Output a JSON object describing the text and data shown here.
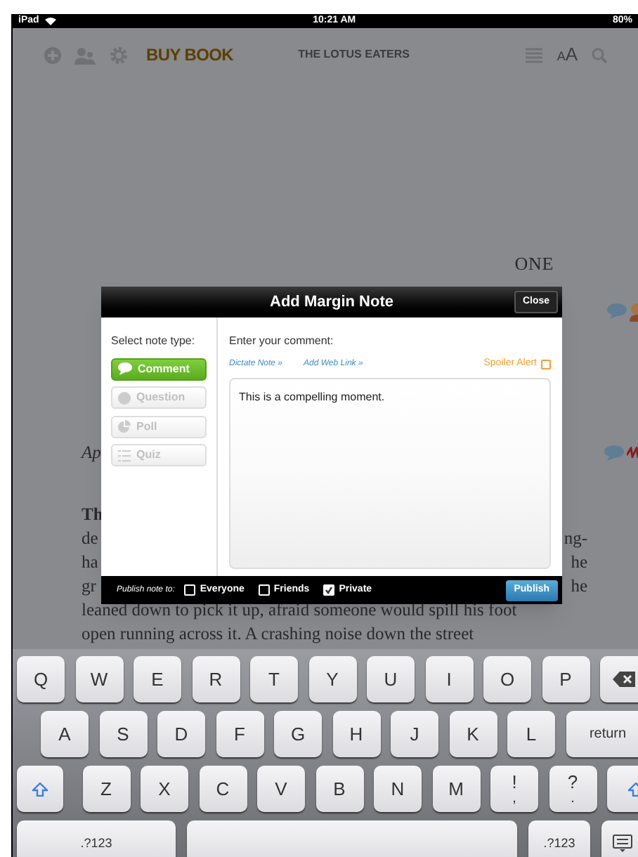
{
  "status_bar": {
    "device": "iPad",
    "time": "10:21 AM",
    "battery": "80%"
  },
  "toolbar": {
    "buy_button": "BUY BOOK",
    "title": "THE LOTUS EATERS",
    "font_button": "AA"
  },
  "book": {
    "chapter": "ONE",
    "lines": [
      {
        "kind": "italic",
        "left": "Ap"
      },
      {
        "kind": "bold",
        "left": "Th"
      },
      {
        "kind": "plain",
        "left": "de",
        "right": "ng-"
      },
      {
        "kind": "plain",
        "left": "ha",
        "right": "he"
      },
      {
        "kind": "plain",
        "left": "gr",
        "right": "he"
      },
      {
        "kind": "plain",
        "left": "leaned down to pick it up, afraid someone would spill his foot"
      },
      {
        "kind": "plain",
        "left": "open running across it. A crashing noise down the street"
      }
    ]
  },
  "dialog": {
    "title": "Add Margin Note",
    "close": "Close",
    "type_label": "Select note type:",
    "note_types": [
      {
        "kind": "comment",
        "label": "Comment",
        "selected": true
      },
      {
        "kind": "question",
        "label": "Question",
        "selected": false
      },
      {
        "kind": "poll",
        "label": "Poll",
        "selected": false
      },
      {
        "kind": "quiz",
        "label": "Quiz",
        "selected": false
      }
    ],
    "comment_label": "Enter your comment:",
    "links": [
      "Dictate Note »",
      "Add Web Link »"
    ],
    "spoiler": {
      "label": "Spoiler Alert",
      "checked": false
    },
    "comment": "This is a compelling moment.",
    "publish_label": "Publish note to:",
    "audiences": [
      {
        "label": "Everyone",
        "checked": false
      },
      {
        "label": "Friends",
        "checked": false
      },
      {
        "label": "Private",
        "checked": true
      }
    ],
    "publish_button": "Publish"
  },
  "keyboard": {
    "rows": [
      {
        "keys": [
          {
            "kind": "letter",
            "label": "Q"
          },
          {
            "kind": "letter",
            "label": "W"
          },
          {
            "kind": "letter",
            "label": "E"
          },
          {
            "kind": "letter",
            "label": "R"
          },
          {
            "kind": "letter",
            "label": "T"
          },
          {
            "kind": "letter",
            "label": "Y"
          },
          {
            "kind": "letter",
            "label": "U"
          },
          {
            "kind": "letter",
            "label": "I"
          },
          {
            "kind": "letter",
            "label": "O"
          },
          {
            "kind": "letter",
            "label": "P"
          },
          {
            "kind": "backspace"
          }
        ]
      },
      {
        "keys": [
          {
            "kind": "letter",
            "label": "A"
          },
          {
            "kind": "letter",
            "label": "S"
          },
          {
            "kind": "letter",
            "label": "D"
          },
          {
            "kind": "letter",
            "label": "F"
          },
          {
            "kind": "letter",
            "label": "G"
          },
          {
            "kind": "letter",
            "label": "H"
          },
          {
            "kind": "letter",
            "label": "J"
          },
          {
            "kind": "letter",
            "label": "K"
          },
          {
            "kind": "letter",
            "label": "L"
          },
          {
            "kind": "return",
            "label": "return"
          }
        ]
      },
      {
        "keys": [
          {
            "kind": "shift"
          },
          {
            "kind": "letter",
            "label": "Z"
          },
          {
            "kind": "letter",
            "label": "X"
          },
          {
            "kind": "letter",
            "label": "C"
          },
          {
            "kind": "letter",
            "label": "V"
          },
          {
            "kind": "letter",
            "label": "B"
          },
          {
            "kind": "letter",
            "label": "N"
          },
          {
            "kind": "letter",
            "label": "M"
          },
          {
            "kind": "punct",
            "label": "!",
            "sub": ","
          },
          {
            "kind": "punct",
            "label": "?",
            "sub": "."
          },
          {
            "kind": "shift"
          }
        ]
      },
      {
        "keys": [
          {
            "kind": "numbers",
            "label": ".?123"
          },
          {
            "kind": "space"
          },
          {
            "kind": "numbers",
            "label": ".?123"
          },
          {
            "kind": "hide"
          }
        ]
      }
    ]
  }
}
